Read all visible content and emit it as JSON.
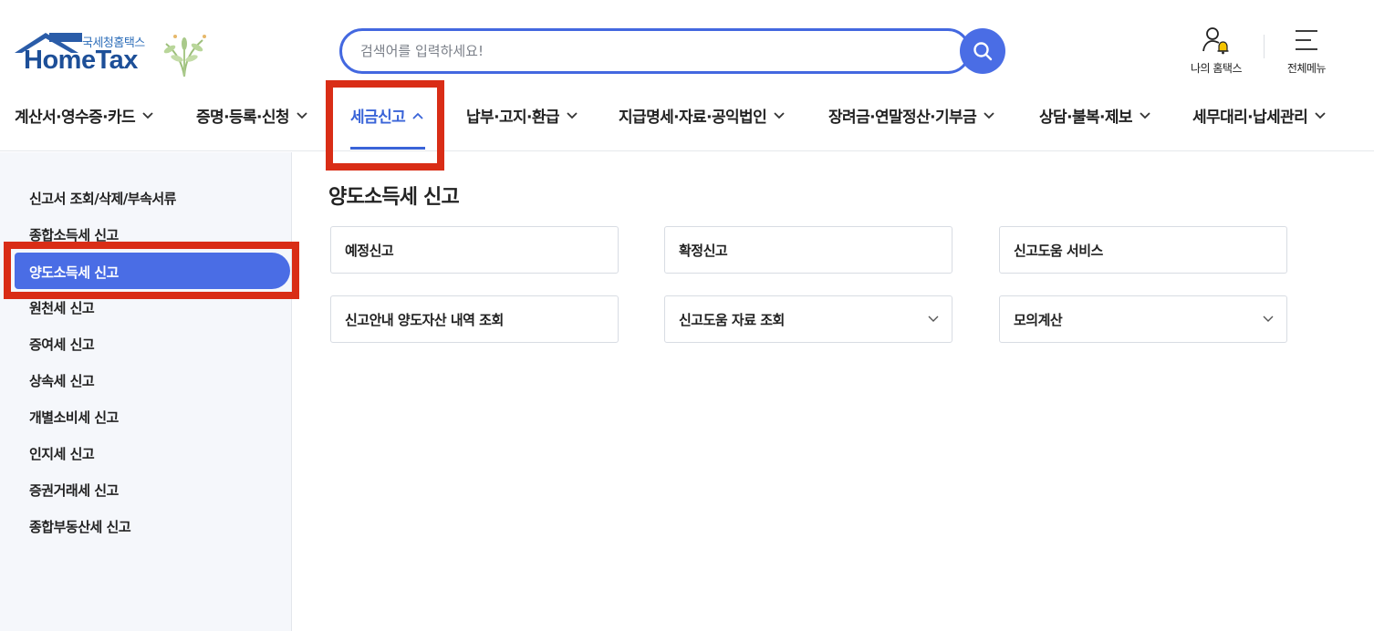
{
  "logo": {
    "subtitle": "국세청홈택스",
    "title": "HomeTax"
  },
  "search": {
    "placeholder": "검색어를 입력하세요!"
  },
  "utility": {
    "my_hometax": "나의 홈택스",
    "all_menu": "전체메뉴"
  },
  "gnb": [
    {
      "label": "계산서·영수증·카드",
      "expanded": false
    },
    {
      "label": "증명·등록·신청",
      "expanded": false
    },
    {
      "label": "세금신고",
      "expanded": true
    },
    {
      "label": "납부·고지·환급",
      "expanded": false
    },
    {
      "label": "지급명세·자료·공익법인",
      "expanded": false
    },
    {
      "label": "장려금·연말정산·기부금",
      "expanded": false
    },
    {
      "label": "상담·불복·제보",
      "expanded": false
    },
    {
      "label": "세무대리·납세관리",
      "expanded": false
    }
  ],
  "sidebar": {
    "items": [
      {
        "label": "신고서 조회/삭제/부속서류"
      },
      {
        "label": "종합소득세 신고"
      },
      {
        "label": "양도소득세 신고",
        "active": true
      },
      {
        "label": "원천세 신고"
      },
      {
        "label": "증여세 신고"
      },
      {
        "label": "상속세 신고"
      },
      {
        "label": "개별소비세 신고"
      },
      {
        "label": "인지세 신고"
      },
      {
        "label": "증권거래세 신고"
      },
      {
        "label": "종합부동산세 신고"
      }
    ]
  },
  "content": {
    "title": "양도소득세 신고",
    "cards": [
      {
        "label": "예정신고",
        "has_dropdown": false
      },
      {
        "label": "확정신고",
        "has_dropdown": false
      },
      {
        "label": "신고도움 서비스",
        "has_dropdown": false
      },
      {
        "label": "신고안내 양도자산 내역 조회",
        "has_dropdown": false
      },
      {
        "label": "신고도움 자료 조회",
        "has_dropdown": true
      },
      {
        "label": "모의계산",
        "has_dropdown": true
      }
    ]
  },
  "colors": {
    "accent": "#4a6de5",
    "active_text": "#3a64d8",
    "highlight": "#d92d16",
    "logo": "#1d4f98"
  },
  "icons": {
    "search": "search-icon",
    "user": "user-icon",
    "bell": "bell-icon",
    "menu": "hamburger-icon",
    "chevron_down": "chevron-down-icon",
    "chevron_up": "chevron-up-icon"
  }
}
